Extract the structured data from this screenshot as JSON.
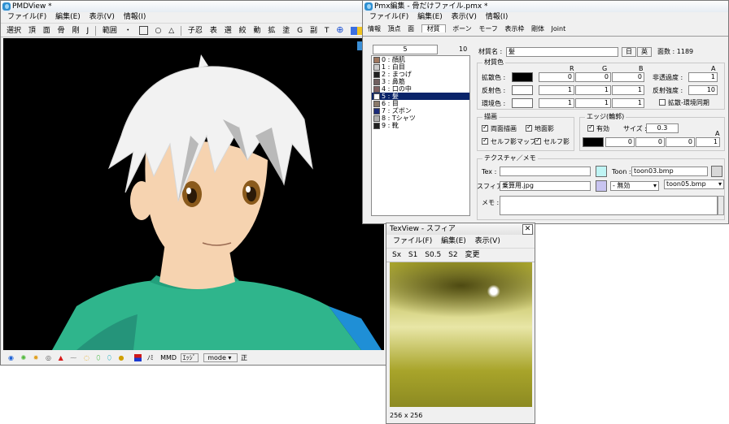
{
  "pmdview": {
    "title": "PMDView *",
    "menu": [
      "ファイル(F)",
      "編集(E)",
      "表示(V)",
      "情報(I)"
    ],
    "toolbar": [
      "選択",
      "頂",
      "面",
      "骨",
      "剛",
      "J",
      "範囲",
      "・",
      "子忍",
      "表",
      "選",
      "絞",
      "動",
      "拡",
      "塗",
      "G",
      "副",
      "T"
    ],
    "bottom": {
      "mini": "ﾉﾐ",
      "mmd": "MMD",
      "edge": "ｴｯｼﾞ",
      "mode": "mode",
      "sei": "正"
    },
    "colors": {
      "viewport_bg": "#000000",
      "skin": "#f6d3b0",
      "hair": "#f2f2f2",
      "shirt": "#2fb58c",
      "eyes": "#8a5a1c"
    }
  },
  "pmx": {
    "title": "Pmx編集 - 骨だけファイル.pmx *",
    "menu": [
      "ファイル(F)",
      "編集(E)",
      "表示(V)",
      "情報(I)"
    ],
    "tabs": [
      "情報",
      "頂点",
      "面",
      "材質",
      "ボーン",
      "モーフ",
      "表示枠",
      "剛体",
      "Joint"
    ],
    "active_tab": 3,
    "counter_current": "5",
    "counter_total": "10",
    "materials": [
      {
        "label": "0 : 顔肌",
        "color": "#a07860"
      },
      {
        "label": "1 : 白目",
        "color": "#cccccc"
      },
      {
        "label": "2 : まつげ",
        "color": "#202020"
      },
      {
        "label": "3 : 鼻筋",
        "color": "#706060"
      },
      {
        "label": "4 : 口の中",
        "color": "#806060"
      },
      {
        "label": "5 : 髪",
        "color": "#ffffff"
      },
      {
        "label": "6 : 目",
        "color": "#8a7a6a"
      },
      {
        "label": "7 : ズボン",
        "color": "#1a2a7a"
      },
      {
        "label": "8 : Tシャツ",
        "color": "#b0b0b0"
      },
      {
        "label": "9 : 靴",
        "color": "#202020"
      }
    ],
    "selected_index": 5,
    "material_name_label": "材質名 :",
    "material_name": "髪",
    "lang_buttons": [
      "日",
      "英"
    ],
    "face_count": "面数 : 1189",
    "material_color_title": "材質色",
    "rgb_headers": [
      "R",
      "G",
      "B"
    ],
    "alpha_header": "A",
    "diffuse": {
      "label": "拡散色 :",
      "swatch": "#000000",
      "r": "0",
      "g": "0",
      "b": "0",
      "a": "1",
      "alpha_label": "非透過度 :"
    },
    "specular": {
      "label": "反射色 :",
      "swatch": "#ffffff",
      "r": "1",
      "g": "1",
      "b": "1",
      "power": "10",
      "power_label": "反射強度 :"
    },
    "ambient": {
      "label": "環境色 :",
      "swatch": "#ffffff",
      "r": "1",
      "g": "1",
      "b": "1",
      "sync_label": "拡散-環境同期"
    },
    "draw_title": "描画",
    "draw_checks": [
      "両面描画",
      "地面影",
      "セルフ影マップ",
      "セルフ影"
    ],
    "edge_title": "エッジ(輪郭)",
    "edge_enabled_label": "有効",
    "edge_size_label": "サイズ :",
    "edge_size": "0.3",
    "edge_swatch": "#000000",
    "edge_rgba": [
      "0",
      "0",
      "0",
      "1"
    ],
    "tex_title": "テクスチャ／メモ",
    "tex_label": "Tex :",
    "tex_value": "",
    "toon_label": "Toon :",
    "toon_value": "toon03.bmp",
    "sphere_label": "スフィア :",
    "sphere_value": "乗算用.jpg",
    "sphere_mode": "- 無効",
    "toon_select": "toon05.bmp",
    "memo_label": "メモ :"
  },
  "texview": {
    "title": "TexView - スフィア",
    "menu": [
      "ファイル(F)",
      "編集(E)",
      "表示(V)"
    ],
    "toolbar": [
      "Sx",
      "S1",
      "S0.5",
      "S2",
      "変更"
    ],
    "size": "256 x 256",
    "colors": {
      "base": "#a8a42a",
      "dark": "#4e4a12",
      "light": "#e8e6a6"
    }
  }
}
